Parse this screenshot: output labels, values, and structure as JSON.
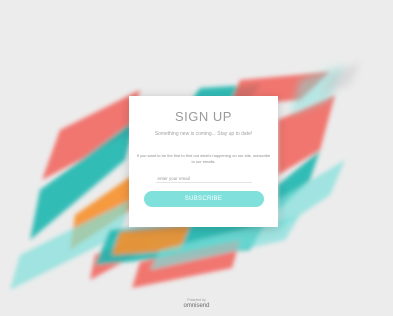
{
  "signup": {
    "title": "SIGN UP",
    "subtitle": "Something new is coming... Stay up to date!",
    "body": "If you want to be the first to find out what's happening on our site, subscribe to our emails.",
    "email_placeholder": "enter your email",
    "button_label": "SUBSCRIBE"
  },
  "footer": {
    "powered_by": "Powered by",
    "brand": "omnisend"
  },
  "colors": {
    "coral": "#f2625a",
    "teal": "#1fb7b0",
    "orange": "#f7912f",
    "mint": "#7fe0dc",
    "background": "#ececec"
  }
}
